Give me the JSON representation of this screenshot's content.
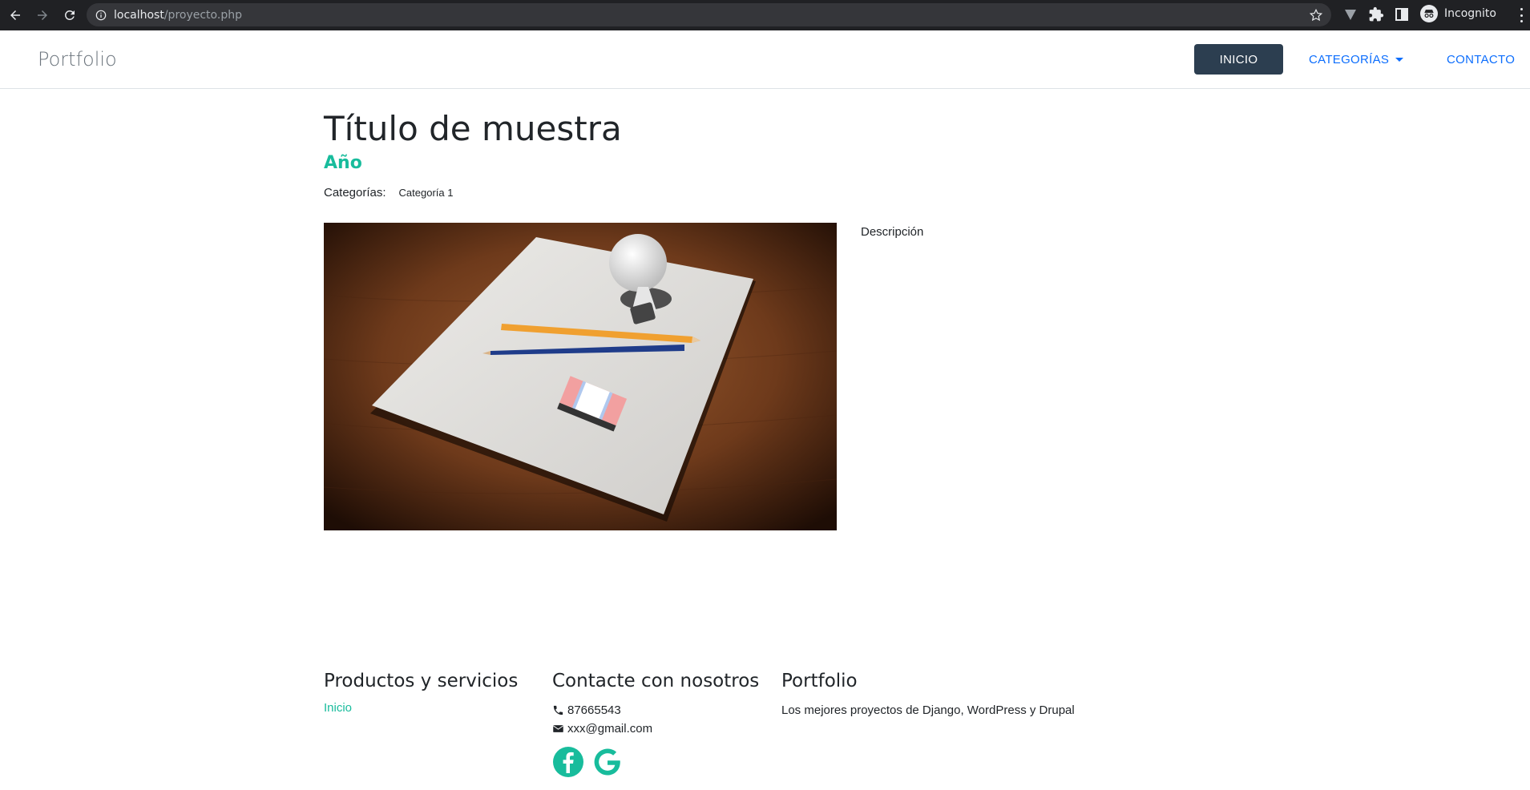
{
  "browser": {
    "url_host": "localhost",
    "url_path": "/proyecto.php",
    "profile_label": "Incognito"
  },
  "navbar": {
    "brand": "Portfolio",
    "items": [
      {
        "label": "INICIO",
        "active": true
      },
      {
        "label": "CATEGORÍAS",
        "dropdown": true
      },
      {
        "label": "CONTACTO"
      }
    ]
  },
  "project": {
    "title": "Título de muestra",
    "year": "Año",
    "categories_label": "Categorías:",
    "categories": [
      "Categoría 1"
    ],
    "description": "Descripción",
    "image_subject": "lightbulb-pencils-paper-illustration"
  },
  "footer": {
    "services": {
      "heading": "Productos y servicios",
      "link": "Inicio"
    },
    "contact": {
      "heading": "Contacte con nosotros",
      "phone": "87665543",
      "email": "xxx@gmail.com",
      "social": [
        "facebook-icon",
        "google-icon"
      ]
    },
    "about": {
      "heading": "Portfolio",
      "text": "Los mejores proyectos de Django, WordPress y Drupal"
    }
  },
  "colors": {
    "accent": "#18bc9c",
    "primary_dark": "#2c3e50",
    "link_blue": "#0d6efd",
    "chrome_bg": "#202124"
  }
}
